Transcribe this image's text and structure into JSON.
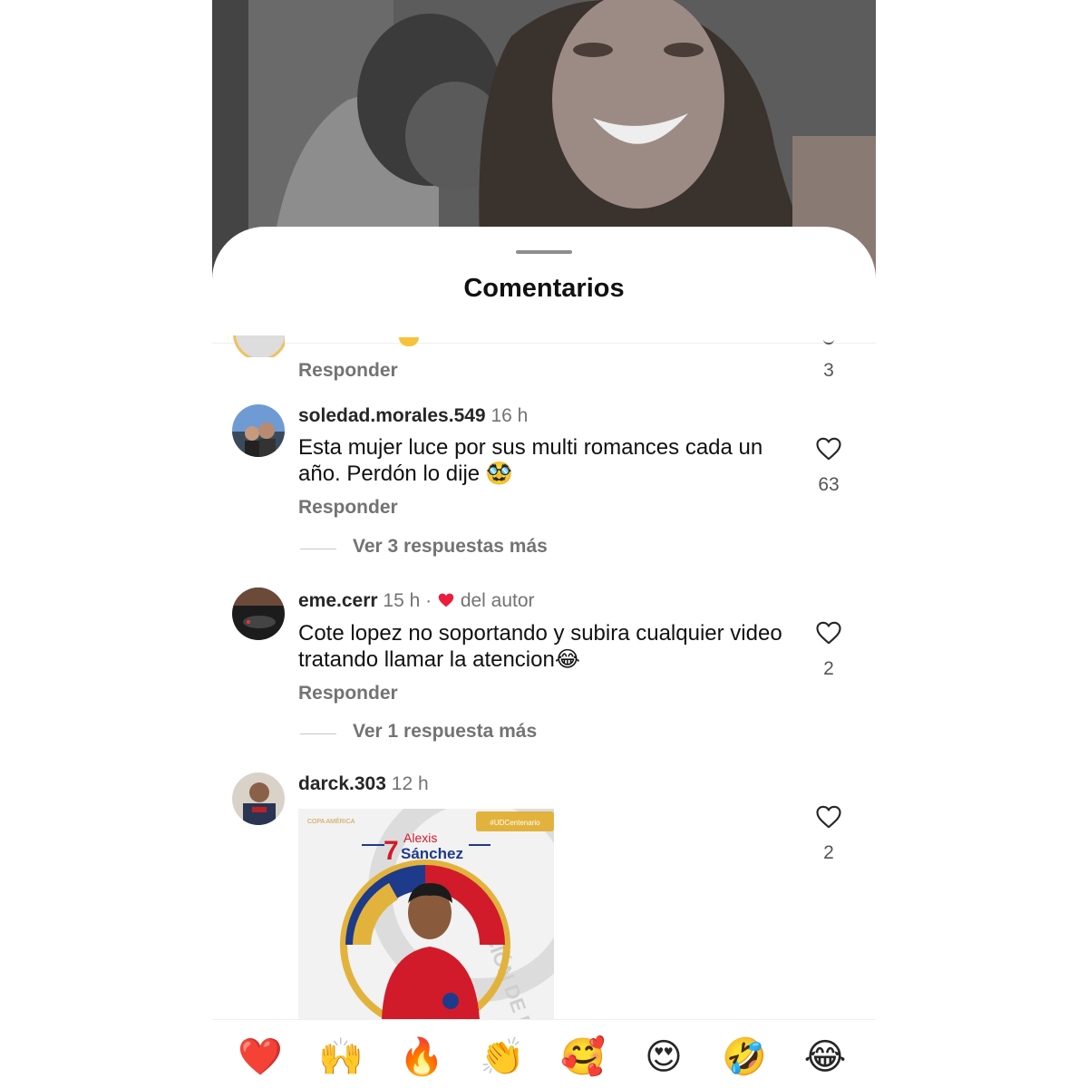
{
  "sheet": {
    "title": "Comentarios"
  },
  "previous_comment": {
    "reply_label": "Responder",
    "like_count": "3"
  },
  "comments": [
    {
      "username": "soledad.morales.549",
      "time": "16 h",
      "text": "Esta mujer luce por sus multi romances cada un año. Perdón lo dije 🥸",
      "reply_label": "Responder",
      "like_count": "63",
      "view_more": "Ver 3 respuestas más"
    },
    {
      "username": "eme.cerr",
      "time": "15 h",
      "separator": "·",
      "author_like": "del autor",
      "text": "Cote lopez no soportando y subira cualquier video tratando llamar la atencion😂",
      "reply_label": "Responder",
      "like_count": "2",
      "view_more": "Ver 1 respuesta más"
    },
    {
      "username": "darck.303",
      "time": "12 h",
      "like_count": "2",
      "image": {
        "tag": "#UDCentenario",
        "brand": "COPA AMÉRICA",
        "player_number": "7",
        "player_first": "Alexis",
        "player_last": "Sánchez",
        "watermark": "CIÓN DE FÚTBOL"
      }
    }
  ],
  "quick_reactions": [
    "❤️",
    "🙌",
    "🔥",
    "👏",
    "🥰",
    "😍",
    "🤣",
    "😂"
  ],
  "colors": {
    "heart": "#ed1c3a",
    "muted": "#737373",
    "accent_gold": "#e2b33c"
  }
}
